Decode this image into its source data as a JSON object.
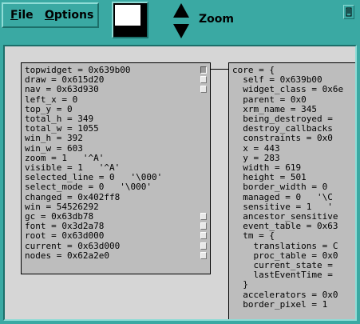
{
  "menu": {
    "file": {
      "mnemonic": "F",
      "rest": "ile"
    },
    "options": {
      "mnemonic": "O",
      "rest": "ptions"
    }
  },
  "toolbar": {
    "zoom_label": "Zoom"
  },
  "left_node": {
    "rows": [
      "topwidget = 0x639b00",
      "draw = 0x615d20",
      "nav = 0x63d930",
      "left_x = 0",
      "top_y = 0",
      "total_h = 349",
      "total_w = 1055",
      "win_h = 392",
      "win_w = 603",
      "zoom = 1   '^A'",
      "visible = 1   '^A'",
      "selected_line = 0   '\\000'",
      "select_mode = 0   '\\000'",
      "changed = 0x402ff8",
      "win = 54526292",
      "gc = 0x63db78",
      "font = 0x3d2a78",
      "root = 0x63d000",
      "current = 0x63d000",
      "nodes = 0x62a2e0"
    ]
  },
  "right_node": {
    "rows": [
      "core = {",
      "  self = 0x639b00",
      "  widget_class = 0x6e",
      "  parent = 0x0",
      "  xrm_name = 345",
      "  being_destroyed =",
      "  destroy_callbacks",
      "  constraints = 0x0",
      "  x = 443",
      "  y = 283",
      "  width = 619",
      "  height = 501",
      "  border_width = 0",
      "  managed = 0   '\\C",
      "  sensitive = 1   '",
      "  ancestor_sensitive",
      "  event_table = 0x63",
      "  tm = {",
      "    translations = C",
      "    proc_table = 0x0",
      "    current_state =",
      "    lastEventTime =",
      "  }",
      "  accelerators = 0x0",
      "  border_pixel = 1"
    ]
  }
}
